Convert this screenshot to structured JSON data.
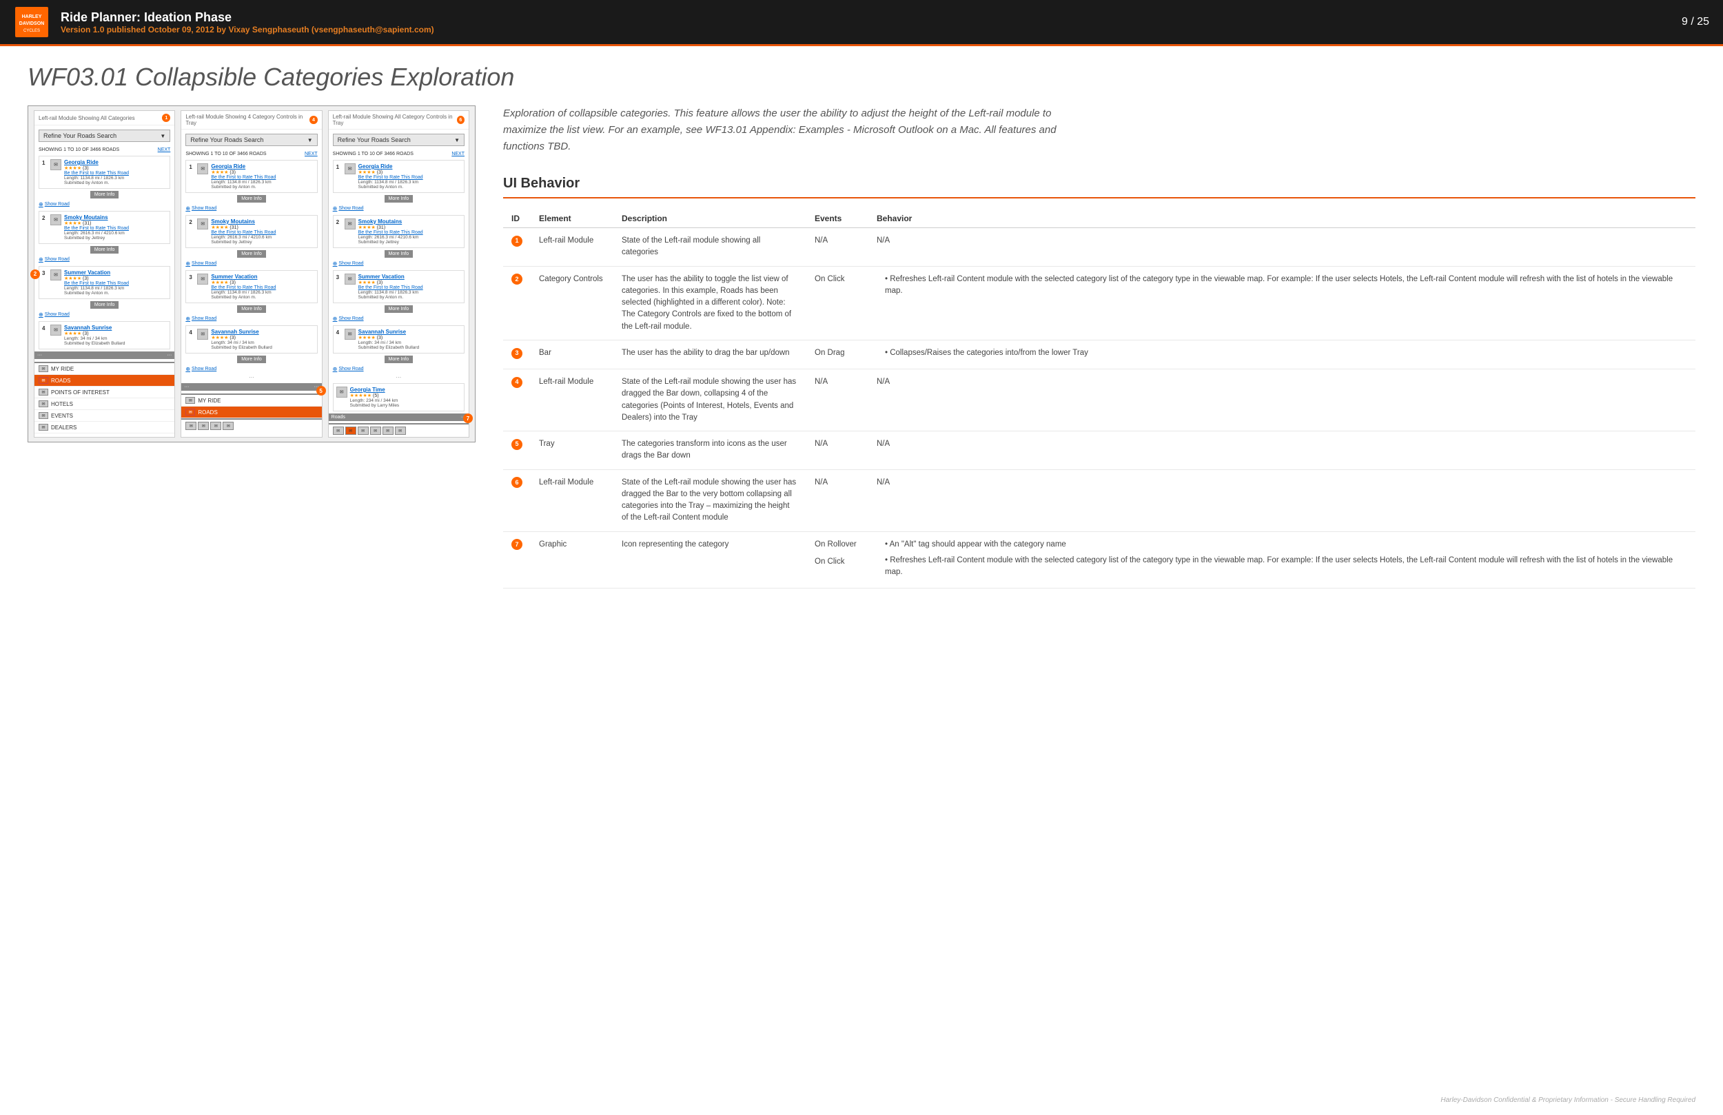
{
  "header": {
    "title": "Ride Planner: Ideation Phase",
    "subtitle_prefix": "Version 1.0 published ",
    "date": "October 09, 2012",
    "subtitle_suffix": " by Vixay Sengphaseuth (vsengphaseuth@sapient.com)",
    "page_num": "9 / 25"
  },
  "page_title": "WF03.01 Collapsible Categories Exploration",
  "wireframe_labels": {
    "panel1": "Left-rail Module Showing All Categories",
    "panel2": "Left-rail Module Showing 4 Category Controls in Tray",
    "panel3": "Left-rail Module Showing All Category Controls in Tray"
  },
  "search_bar": {
    "text": "Refine Your Roads Search"
  },
  "results_count": "SHOWING 1 TO 10 OF 3466 ROADS",
  "next_link": "NEXT",
  "rides": [
    {
      "num": "1",
      "title": "Georgia Ride",
      "stars": "★★★★",
      "review_count": "(3)",
      "subtitle": "Be the First to Rate This Road",
      "length": "Length: 1134.8 mi / 1826.3 km",
      "submitted": "Submitted by Anton m.",
      "btn": "More Info",
      "show": "Show Road"
    },
    {
      "num": "2",
      "title": "Smoky Moutains",
      "stars": "★★★★",
      "review_count": "(31)",
      "subtitle": "Be the First to Rate This Road",
      "length": "Length: 2616.3 mi / 4210.6 km",
      "submitted": "Submitted by Jettrey",
      "btn": "More Info",
      "show": "Show Road"
    },
    {
      "num": "3",
      "title": "Summer Vacation",
      "stars": "★★★★",
      "review_count": "(3)",
      "subtitle": "Be the First to Rate This Road",
      "length": "Length: 1134.8 mi / 1826.3 km",
      "submitted": "Submitted by Anton m.",
      "btn": "More Info",
      "show": "Show Road"
    },
    {
      "num": "4",
      "title": "Savannah Sunrise",
      "stars": "★★★★",
      "review_count": "(3)",
      "length": "Length: 34 mi / 34 km",
      "submitted": "Submitted by Elizabeth Bullard",
      "btn": "More Info",
      "show": "Show Road"
    }
  ],
  "georgia_time": {
    "title": "Georgia Time",
    "stars": "★★★★★",
    "review_count": "(5)",
    "length": "Length: 234 mi / 344 km",
    "submitted": "Submitted by Larry Miles"
  },
  "categories": [
    {
      "label": "MY RIDE",
      "active": false
    },
    {
      "label": "ROADS",
      "active": true
    },
    {
      "label": "POINTS OF INTEREST",
      "active": false
    },
    {
      "label": "HOTELS",
      "active": false
    },
    {
      "label": "EVENTS",
      "active": false
    },
    {
      "label": "DEALERS",
      "active": false
    }
  ],
  "description": "Exploration of collapsible categories. This feature allows the user the ability to adjust the height of the Left-rail module to maximize the list view. For an example, see WF13.01 Appendix: Examples - Microsoft Outlook on a Mac. All features and functions TBD.",
  "ui_behavior": {
    "title": "UI Behavior",
    "columns": [
      "ID",
      "Element",
      "Description",
      "Events",
      "Behavior"
    ],
    "rows": [
      {
        "id": "1",
        "element": "Left-rail Module",
        "description": "State of the Left-rail module showing all categories",
        "events": "N/A",
        "behavior": "N/A"
      },
      {
        "id": "2",
        "element": "Category Controls",
        "description": "The user has the ability to toggle the list view of categories. In this example, Roads has been selected (highlighted in a different color). Note: The Category Controls are fixed to the bottom of the Left-rail module.",
        "events": "On Click",
        "behavior_bullets": [
          "Refreshes Left-rail Content module with the selected category list of the category type in the viewable map. For example: If the user selects Hotels, the Left-rail Content module will refresh with the list of hotels in the viewable map."
        ]
      },
      {
        "id": "3",
        "element": "Bar",
        "description": "The user has the ability to drag the bar up/down",
        "events": "On Drag",
        "behavior_bullets": [
          "Collapses/Raises the categories into/from the lower Tray"
        ]
      },
      {
        "id": "4",
        "element": "Left-rail Module",
        "description": "State of the Left-rail module showing the user has dragged the Bar down, collapsing 4 of the categories (Points of Interest, Hotels, Events and Dealers) into the Tray",
        "events": "N/A",
        "behavior": "N/A"
      },
      {
        "id": "5",
        "element": "Tray",
        "description": "The categories transform into icons as the user drags the Bar down",
        "events": "N/A",
        "behavior": "N/A"
      },
      {
        "id": "6",
        "element": "Left-rail Module",
        "description": "State of the Left-rail module showing the user has dragged the Bar to the very bottom collapsing all categories into the Tray – maximizing the height of the Left-rail Content module",
        "events": "N/A",
        "behavior": "N/A"
      },
      {
        "id": "7",
        "element": "Graphic",
        "description": "Icon representing the category",
        "events_multi": [
          "On Rollover",
          "On Click"
        ],
        "behavior_bullets": [
          "An \"Alt\" tag should appear with the category name",
          "Refreshes Left-rail Content module with the selected category list of the category type in the viewable map. For example: If the user selects Hotels, the Left-rail Content module will refresh with the list of hotels in the viewable map."
        ]
      }
    ]
  },
  "footer": "Harley-Davidson Confidential & Proprietary Information - Secure Handling Required"
}
